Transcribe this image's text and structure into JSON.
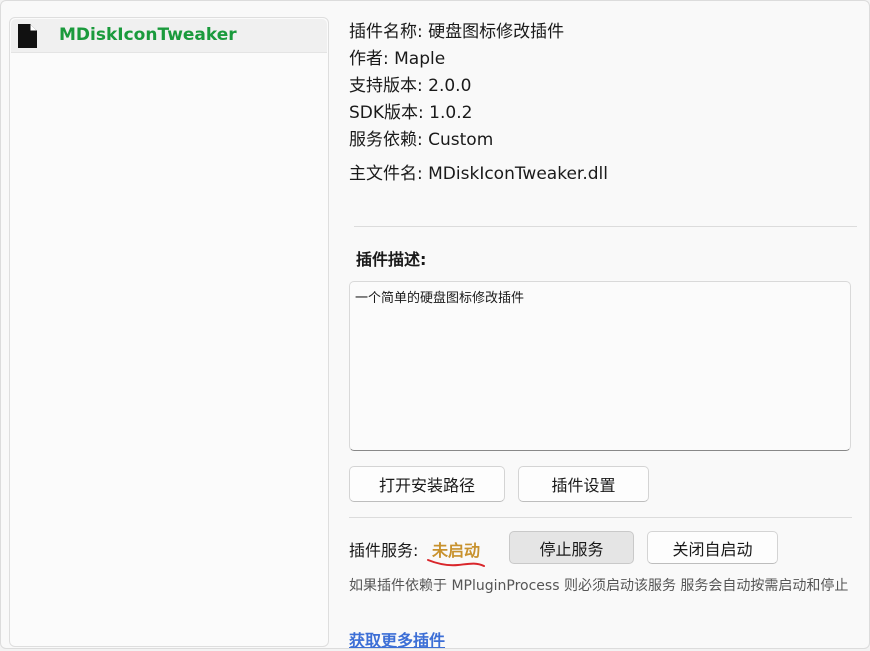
{
  "plugin_list": {
    "items": [
      {
        "name": "MDiskIconTweaker",
        "icon": "file-icon"
      }
    ]
  },
  "info": {
    "name": "插件名称: 硬盘图标修改插件",
    "author": "作者: Maple",
    "supported_version": "支持版本: 2.0.0",
    "sdk_version": "SDK版本: 1.0.2",
    "dependency": "服务依赖: Custom",
    "main_file": "主文件名: MDiskIconTweaker.dll"
  },
  "description": {
    "title": "插件描述:",
    "text": "一个简单的硬盘图标修改插件"
  },
  "actions": {
    "open_path": "打开安装路径",
    "settings": "插件设置"
  },
  "service": {
    "label": "插件服务:",
    "status": "未启动",
    "status_color": "#c8922e",
    "stop_button": "停止服务",
    "autostart_button": "关闭自启动",
    "note": "如果插件依赖于 MPluginProcess 则必须启动该服务 服务会自动按需启动和停止"
  },
  "footer": {
    "more_plugins": "获取更多插件"
  },
  "colors": {
    "accent_green": "#1a9a3c",
    "link_blue": "#3d6fd6",
    "annotation_red": "#d9262b"
  }
}
